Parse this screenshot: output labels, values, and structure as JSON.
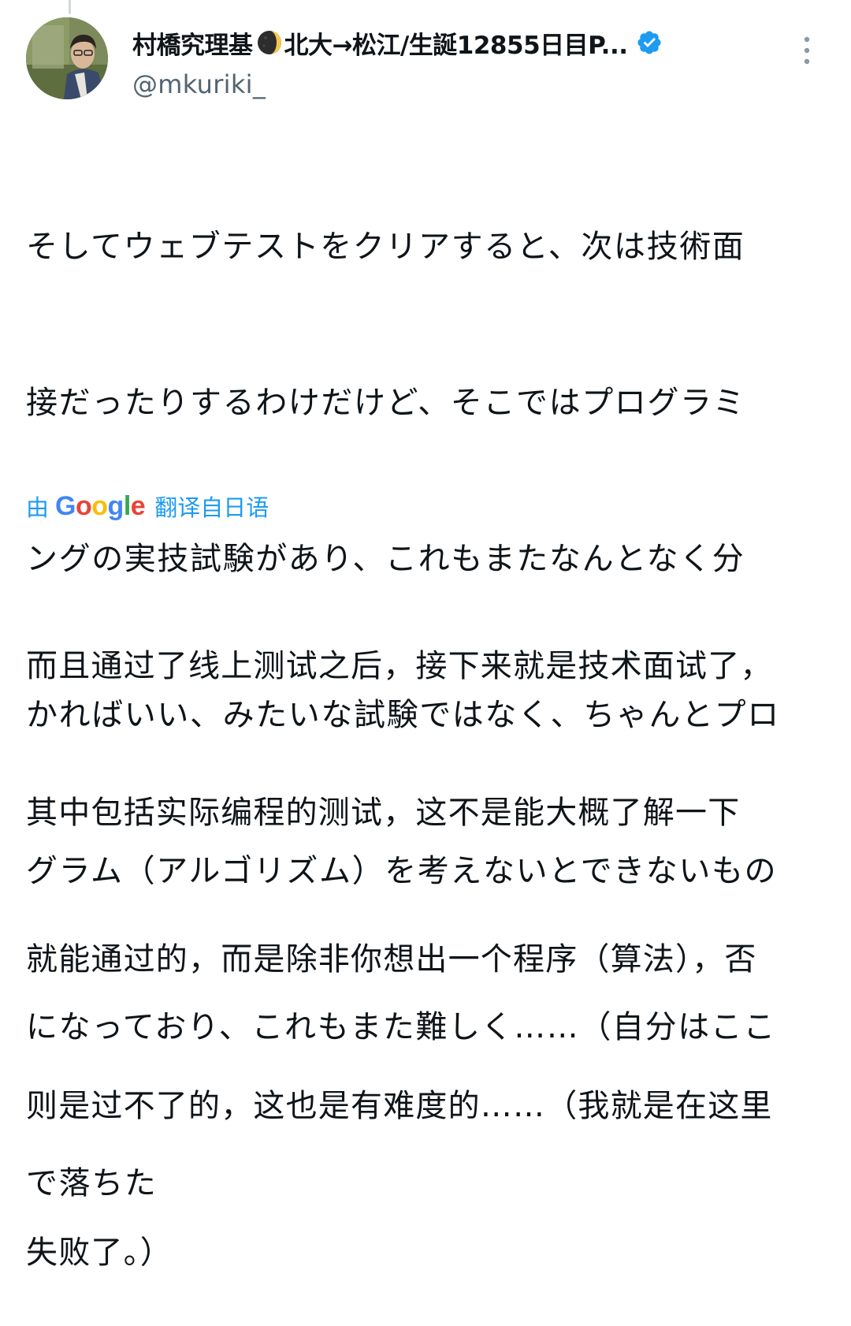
{
  "post": {
    "author": {
      "name_part1": "村橋究理基",
      "name_part2": "北大→松江/生誕12855日目P...",
      "handle": "@mkuriki_",
      "verified": true
    },
    "icons": {
      "emoji_in_name": "moon-icon",
      "verified_badge": "verified-badge-icon",
      "more_menu": "more-vertical-icon"
    },
    "original_lines": [
      "そしてウェブテストをクリアすると、次は技術面",
      "接だったりするわけだけど、そこではプログラミ",
      "ングの実技試験があり、これもまたなんとなく分",
      "かればいい、みたいな試験ではなく、ちゃんとプロ",
      "グラム（アルゴリズム）を考えないとできないもの",
      "になっており、これもまた難しく……（自分はここ",
      "で落ちた"
    ],
    "translation_bar": {
      "by_label": "由",
      "google_logo": "Google",
      "translated_from": "翻译自日语"
    },
    "translated_lines": [
      "而且通过了线上测试之后，接下来就是技术面试了，",
      "其中包括实际编程的测试，这不是能大概了解一下",
      "就能通过的，而是除非你想出一个程序（算法），否",
      "则是过不了的，这也是有难度的……（我就是在这里",
      "失败了。）"
    ]
  },
  "colors": {
    "text_primary": "#0f1419",
    "text_secondary": "#536471",
    "link_blue": "#1d9bf0",
    "verified_blue": "#1d9bf0",
    "google_blue": "#4285f4",
    "google_red": "#ea4335",
    "google_yellow": "#fbbc05",
    "google_green": "#34a853"
  }
}
